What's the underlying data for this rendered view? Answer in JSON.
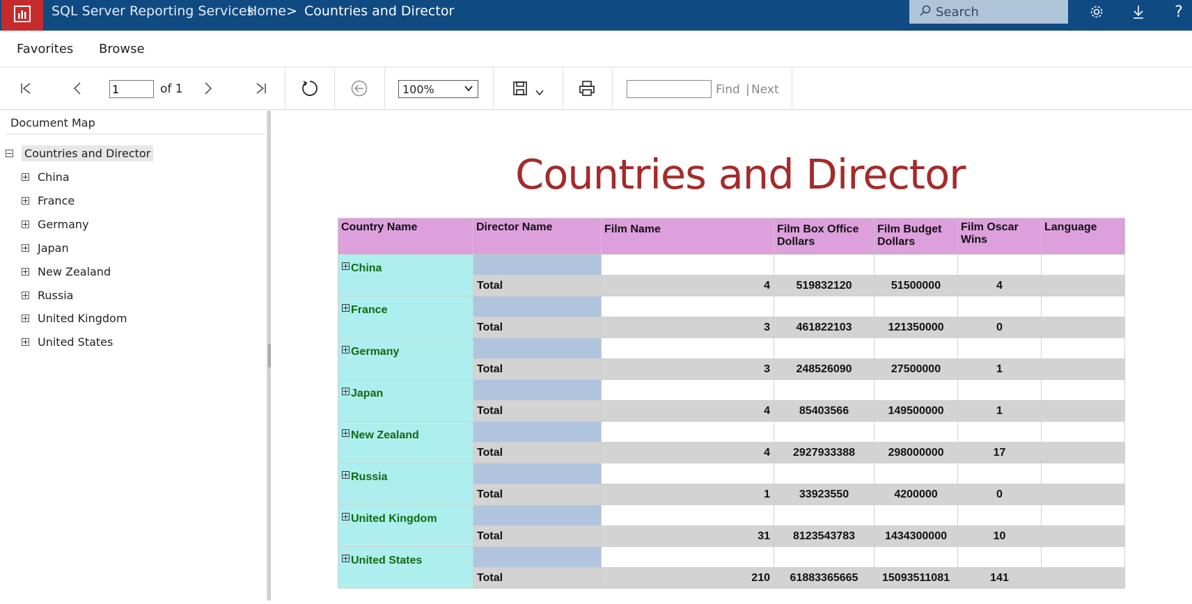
{
  "topbar": {
    "app_title": "SQL Server Reporting Services",
    "crumb_home": "Home",
    "crumb_sep": ">",
    "crumb_current": "Countries and Director",
    "search_placeholder": "Search"
  },
  "nav": {
    "favorites": "Favorites",
    "browse": "Browse"
  },
  "toolbar": {
    "page_value": "1",
    "page_of": "of 1",
    "zoom": "100%",
    "find_label": "Find",
    "find_sep": "|",
    "next_label": "Next"
  },
  "docmap": {
    "title": "Document Map",
    "root": "Countries and Director",
    "items": [
      "China",
      "France",
      "Germany",
      "Japan",
      "New Zealand",
      "Russia",
      "United Kingdom",
      "United States"
    ]
  },
  "report": {
    "title": "Countries and Director",
    "columns": [
      "Country Name",
      "Director Name",
      "Film Name",
      "Film Box Office Dollars",
      "Film Budget Dollars",
      "Film Oscar Wins",
      "Language"
    ],
    "total_label": "Total",
    "groups": [
      {
        "country": "China",
        "film_count": "4",
        "box_office": "519832120",
        "budget": "51500000",
        "oscars": "4"
      },
      {
        "country": "France",
        "film_count": "3",
        "box_office": "461822103",
        "budget": "121350000",
        "oscars": "0"
      },
      {
        "country": "Germany",
        "film_count": "3",
        "box_office": "248526090",
        "budget": "27500000",
        "oscars": "1"
      },
      {
        "country": "Japan",
        "film_count": "4",
        "box_office": "85403566",
        "budget": "149500000",
        "oscars": "1"
      },
      {
        "country": "New Zealand",
        "film_count": "4",
        "box_office": "2927933388",
        "budget": "298000000",
        "oscars": "17"
      },
      {
        "country": "Russia",
        "film_count": "1",
        "box_office": "33923550",
        "budget": "4200000",
        "oscars": "0"
      },
      {
        "country": "United Kingdom",
        "film_count": "31",
        "box_office": "8123543783",
        "budget": "1434300000",
        "oscars": "10"
      },
      {
        "country": "United States",
        "film_count": "210",
        "box_office": "61883365665",
        "budget": "15093511081",
        "oscars": "141"
      }
    ]
  },
  "colors": {
    "topbar": "#0f4a82",
    "logo": "#c52b2b",
    "title": "#a52a2a",
    "header": "#dda0dd",
    "country": "#afeeee",
    "director": "#b0c4de",
    "total": "#d3d3d3",
    "country_text": "#0f6b0f"
  }
}
